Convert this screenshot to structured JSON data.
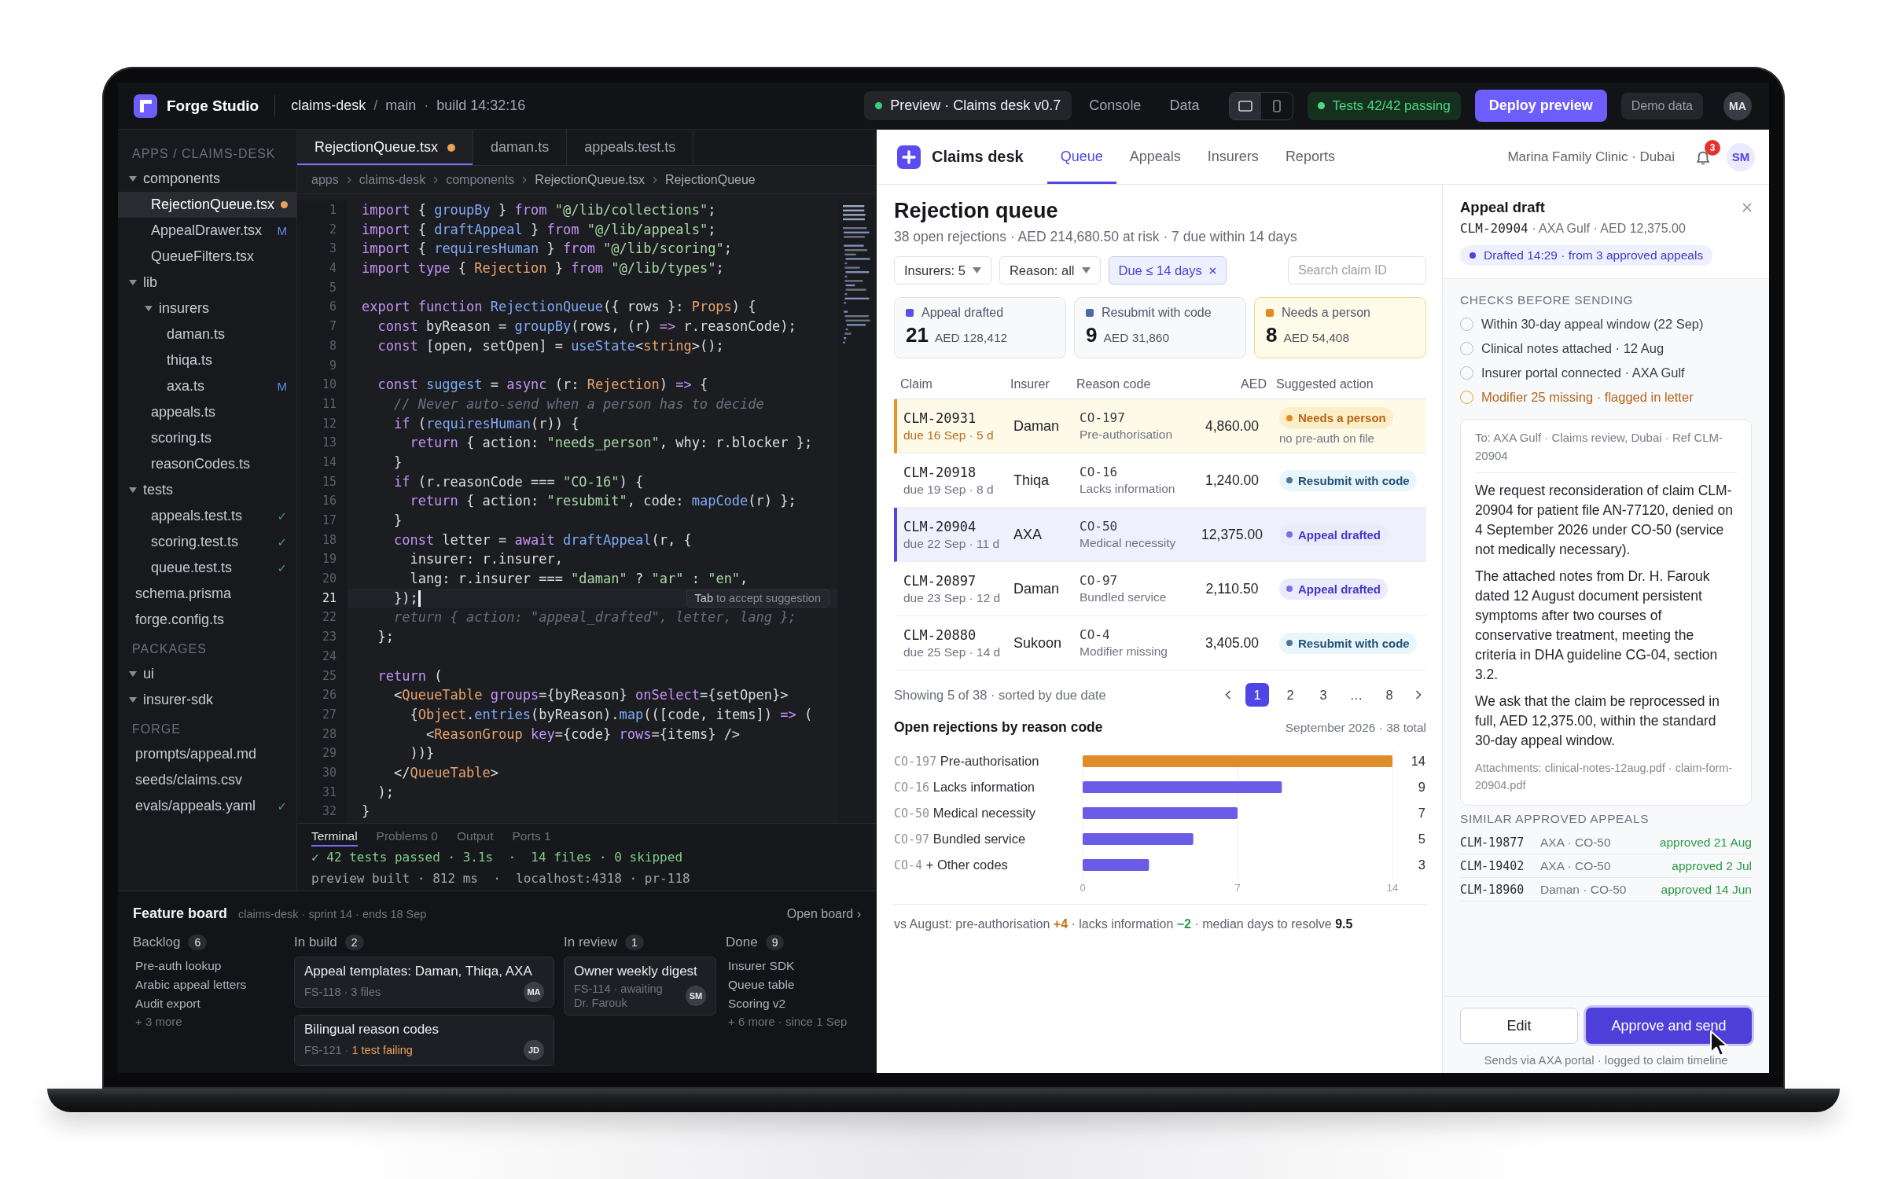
{
  "top_bar": {
    "app_name": "Forge Studio",
    "project": "claims-desk",
    "path_separator": "/",
    "branch": "main",
    "build_separator": "·",
    "build": "build 14:32:16",
    "views": [
      {
        "label": "Preview · Claims desk v0.7",
        "selected": true,
        "live": true
      },
      {
        "label": "Console",
        "selected": false,
        "live": false
      },
      {
        "label": "Data",
        "selected": false,
        "live": false
      }
    ],
    "devices": [
      {
        "kind": "desktop",
        "selected": true
      },
      {
        "kind": "mobile",
        "selected": false
      }
    ],
    "tests": {
      "label": "Tests 42/42 passing",
      "passing": true
    },
    "deploy_button": "Deploy preview",
    "demo_chip": "Demo data",
    "avatar": "MA"
  },
  "explorer": {
    "sections": [
      {
        "title": "APPS / CLAIMS-DESK",
        "items": [
          {
            "kind": "folder",
            "label": "components",
            "expanded": true,
            "selected": false,
            "children": [
              {
                "kind": "file",
                "label": "RejectionQueue.tsx",
                "selected": true,
                "unsaved": true
              },
              {
                "kind": "file",
                "label": "AppealDrawer.tsx",
                "selected": false,
                "unsaved": false,
                "badge": {
                  "kind": "modified",
                  "text": "M"
                }
              },
              {
                "kind": "file",
                "label": "QueueFilters.tsx",
                "selected": false,
                "unsaved": false
              }
            ]
          },
          {
            "kind": "folder",
            "label": "lib",
            "expanded": true,
            "selected": false,
            "children": [
              {
                "kind": "folder",
                "label": "insurers",
                "expanded": true,
                "selected": false,
                "children": [
                  {
                    "kind": "file",
                    "label": "daman.ts",
                    "selected": false,
                    "unsaved": false
                  },
                  {
                    "kind": "file",
                    "label": "thiqa.ts",
                    "selected": false,
                    "unsaved": false
                  },
                  {
                    "kind": "file",
                    "label": "axa.ts",
                    "selected": false,
                    "unsaved": false,
                    "badge": {
                      "kind": "modified",
                      "text": "M"
                    }
                  }
                ]
              },
              {
                "kind": "file",
                "label": "appeals.ts",
                "selected": false,
                "unsaved": false
              },
              {
                "kind": "file",
                "label": "scoring.ts",
                "selected": false,
                "unsaved": false
              },
              {
                "kind": "file",
                "label": "reasonCodes.ts",
                "selected": false,
                "unsaved": false
              }
            ]
          },
          {
            "kind": "folder",
            "label": "tests",
            "expanded": true,
            "selected": false,
            "children": [
              {
                "kind": "file",
                "label": "appeals.test.ts",
                "selected": false,
                "unsaved": false,
                "badge": {
                  "kind": "passing",
                  "text": "✓"
                }
              },
              {
                "kind": "file",
                "label": "scoring.test.ts",
                "selected": false,
                "unsaved": false,
                "badge": {
                  "kind": "passing",
                  "text": "✓"
                }
              },
              {
                "kind": "file",
                "label": "queue.test.ts",
                "selected": false,
                "unsaved": false,
                "badge": {
                  "kind": "passing",
                  "text": "✓"
                }
              }
            ]
          },
          {
            "kind": "file",
            "label": "schema.prisma",
            "selected": false,
            "unsaved": false
          },
          {
            "kind": "file",
            "label": "forge.config.ts",
            "selected": false,
            "unsaved": false
          }
        ]
      },
      {
        "title": "PACKAGES",
        "items": [
          {
            "kind": "folder",
            "label": "ui",
            "expanded": true,
            "selected": false
          },
          {
            "kind": "folder",
            "label": "insurer-sdk",
            "expanded": true,
            "selected": false
          }
        ]
      },
      {
        "title": "FORGE",
        "items": [
          {
            "kind": "file",
            "label": "prompts/appeal.md",
            "selected": false,
            "unsaved": false
          },
          {
            "kind": "file",
            "label": "seeds/claims.csv",
            "selected": false,
            "unsaved": false
          },
          {
            "kind": "file",
            "label": "evals/appeals.yaml",
            "selected": false,
            "unsaved": false,
            "badge": {
              "kind": "passing",
              "text": "✓"
            }
          }
        ]
      }
    ]
  },
  "editor": {
    "tabs": [
      {
        "label": "RejectionQueue.tsx",
        "selected": true,
        "unsaved": true
      },
      {
        "label": "daman.ts",
        "selected": false,
        "unsaved": false
      },
      {
        "label": "appeals.test.ts",
        "selected": false,
        "unsaved": false
      }
    ],
    "breadcrumb": [
      "apps",
      "claims-desk",
      "components",
      "RejectionQueue.tsx",
      "RejectionQueue"
    ],
    "lines": [
      {
        "number": "1",
        "current": false,
        "tokens": [
          {
            "kind": "keyword",
            "text": "import"
          },
          {
            "kind": "plain",
            "text": " { "
          },
          {
            "kind": "function",
            "text": "groupBy"
          },
          {
            "kind": "plain",
            "text": " } "
          },
          {
            "kind": "keyword",
            "text": "from"
          },
          {
            "kind": "string",
            "text": " \"@/lib/collections\""
          },
          {
            "kind": "plain",
            "text": ";"
          }
        ]
      },
      {
        "number": "2",
        "current": false,
        "tokens": [
          {
            "kind": "keyword",
            "text": "import"
          },
          {
            "kind": "plain",
            "text": " { "
          },
          {
            "kind": "function",
            "text": "draftAppeal"
          },
          {
            "kind": "plain",
            "text": " } "
          },
          {
            "kind": "keyword",
            "text": "from"
          },
          {
            "kind": "string",
            "text": " \"@/lib/appeals\""
          },
          {
            "kind": "plain",
            "text": ";"
          }
        ]
      },
      {
        "number": "3",
        "current": false,
        "tokens": [
          {
            "kind": "keyword",
            "text": "import"
          },
          {
            "kind": "plain",
            "text": " { "
          },
          {
            "kind": "function",
            "text": "requiresHuman"
          },
          {
            "kind": "plain",
            "text": " } "
          },
          {
            "kind": "keyword",
            "text": "from"
          },
          {
            "kind": "string",
            "text": " \"@/lib/scoring\""
          },
          {
            "kind": "plain",
            "text": ";"
          }
        ]
      },
      {
        "number": "4",
        "current": false,
        "tokens": [
          {
            "kind": "keyword",
            "text": "import type"
          },
          {
            "kind": "plain",
            "text": " { "
          },
          {
            "kind": "type",
            "text": "Rejection"
          },
          {
            "kind": "plain",
            "text": " } "
          },
          {
            "kind": "keyword",
            "text": "from"
          },
          {
            "kind": "string",
            "text": " \"@/lib/types\""
          },
          {
            "kind": "plain",
            "text": ";"
          }
        ]
      },
      {
        "number": "5",
        "current": false
      },
      {
        "number": "6",
        "current": false,
        "tokens": [
          {
            "kind": "keyword",
            "text": "export function"
          },
          {
            "kind": "function",
            "text": " RejectionQueue"
          },
          {
            "kind": "plain",
            "text": "({ rows }: "
          },
          {
            "kind": "type",
            "text": "Props"
          },
          {
            "kind": "plain",
            "text": ") {"
          }
        ]
      },
      {
        "number": "7",
        "current": false,
        "tokens": [
          {
            "kind": "keyword",
            "text": "  const"
          },
          {
            "kind": "plain",
            "text": " byReason = "
          },
          {
            "kind": "function",
            "text": "groupBy"
          },
          {
            "kind": "plain",
            "text": "(rows, (r) "
          },
          {
            "kind": "keyword",
            "text": "=>"
          },
          {
            "kind": "plain",
            "text": " r.reasonCode);"
          }
        ]
      },
      {
        "number": "8",
        "current": false,
        "tokens": [
          {
            "kind": "keyword",
            "text": "  const"
          },
          {
            "kind": "plain",
            "text": " [open, setOpen] = "
          },
          {
            "kind": "function",
            "text": "useState"
          },
          {
            "kind": "plain",
            "text": "<"
          },
          {
            "kind": "type",
            "text": "string"
          },
          {
            "kind": "plain",
            "text": ">();"
          }
        ]
      },
      {
        "number": "9",
        "current": false
      },
      {
        "number": "10",
        "current": false,
        "tokens": [
          {
            "kind": "keyword",
            "text": "  const"
          },
          {
            "kind": "function",
            "text": " suggest"
          },
          {
            "kind": "plain",
            "text": " = "
          },
          {
            "kind": "keyword",
            "text": "async"
          },
          {
            "kind": "plain",
            "text": " (r: "
          },
          {
            "kind": "type",
            "text": "Rejection"
          },
          {
            "kind": "plain",
            "text": ") "
          },
          {
            "kind": "keyword",
            "text": "=>"
          },
          {
            "kind": "plain",
            "text": " {"
          }
        ]
      },
      {
        "number": "11",
        "current": false,
        "tokens": [
          {
            "kind": "comment",
            "text": "    // Never auto-send when a person has to decide"
          }
        ]
      },
      {
        "number": "12",
        "current": false,
        "tokens": [
          {
            "kind": "keyword",
            "text": "    if"
          },
          {
            "kind": "plain",
            "text": " ("
          },
          {
            "kind": "function",
            "text": "requiresHuman"
          },
          {
            "kind": "plain",
            "text": "(r)) {"
          }
        ]
      },
      {
        "number": "13",
        "current": false,
        "tokens": [
          {
            "kind": "keyword",
            "text": "      return"
          },
          {
            "kind": "plain",
            "text": " { action: "
          },
          {
            "kind": "string",
            "text": "\"needs_person\""
          },
          {
            "kind": "plain",
            "text": ", why: r.blocker };"
          }
        ]
      },
      {
        "number": "14",
        "current": false,
        "tokens": [
          {
            "kind": "plain",
            "text": "    }"
          }
        ]
      },
      {
        "number": "15",
        "current": false,
        "tokens": [
          {
            "kind": "keyword",
            "text": "    if"
          },
          {
            "kind": "plain",
            "text": " (r.reasonCode === "
          },
          {
            "kind": "string",
            "text": "\"CO-16\""
          },
          {
            "kind": "plain",
            "text": ") {"
          }
        ]
      },
      {
        "number": "16",
        "current": false,
        "tokens": [
          {
            "kind": "keyword",
            "text": "      return"
          },
          {
            "kind": "plain",
            "text": " { action: "
          },
          {
            "kind": "string",
            "text": "\"resubmit\""
          },
          {
            "kind": "plain",
            "text": ", code: "
          },
          {
            "kind": "function",
            "text": "mapCode"
          },
          {
            "kind": "plain",
            "text": "(r) };"
          }
        ]
      },
      {
        "number": "17",
        "current": false,
        "tokens": [
          {
            "kind": "plain",
            "text": "    }"
          }
        ]
      },
      {
        "number": "18",
        "current": false,
        "tokens": [
          {
            "kind": "keyword",
            "text": "    const"
          },
          {
            "kind": "plain",
            "text": " letter = "
          },
          {
            "kind": "keyword",
            "text": "await"
          },
          {
            "kind": "function",
            "text": " draftAppeal"
          },
          {
            "kind": "plain",
            "text": "(r, {"
          }
        ]
      },
      {
        "number": "19",
        "current": false,
        "tokens": [
          {
            "kind": "plain",
            "text": "      insurer: r.insurer,"
          }
        ]
      },
      {
        "number": "20",
        "current": false,
        "tokens": [
          {
            "kind": "plain",
            "text": "      lang: r.insurer === "
          },
          {
            "kind": "string",
            "text": "\"daman\""
          },
          {
            "kind": "plain",
            "text": " ? "
          },
          {
            "kind": "string",
            "text": "\"ar\""
          },
          {
            "kind": "plain",
            "text": " : "
          },
          {
            "kind": "string",
            "text": "\"en\""
          },
          {
            "kind": "plain",
            "text": ","
          }
        ]
      },
      {
        "number": "21",
        "current": true,
        "tokens": [
          {
            "kind": "plain",
            "text": "    });"
          }
        ],
        "hint": "**Tab** to accept suggestion"
      },
      {
        "number": "22",
        "current": false,
        "tokens": [
          {
            "kind": "ghost",
            "text": "    return { action: \"appeal_drafted\", letter, lang };"
          }
        ]
      },
      {
        "number": "23",
        "current": false,
        "tokens": [
          {
            "kind": "plain",
            "text": "  };"
          }
        ]
      },
      {
        "number": "24",
        "current": false
      },
      {
        "number": "25",
        "current": false,
        "tokens": [
          {
            "kind": "keyword",
            "text": "  return"
          },
          {
            "kind": "plain",
            "text": " ("
          }
        ]
      },
      {
        "number": "26",
        "current": false,
        "tokens": [
          {
            "kind": "plain",
            "text": "    <"
          },
          {
            "kind": "type",
            "text": "QueueTable"
          },
          {
            "kind": "attribute",
            "text": " groups"
          },
          {
            "kind": "plain",
            "text": "={byReason} "
          },
          {
            "kind": "attribute",
            "text": "onSelect"
          },
          {
            "kind": "plain",
            "text": "={setOpen}>"
          }
        ]
      },
      {
        "number": "27",
        "current": false,
        "tokens": [
          {
            "kind": "plain",
            "text": "      {"
          },
          {
            "kind": "type",
            "text": "Object"
          },
          {
            "kind": "plain",
            "text": "."
          },
          {
            "kind": "function",
            "text": "entries"
          },
          {
            "kind": "plain",
            "text": "(byReason)."
          },
          {
            "kind": "function",
            "text": "map"
          },
          {
            "kind": "plain",
            "text": "(([code, items]) "
          },
          {
            "kind": "keyword",
            "text": "=>"
          },
          {
            "kind": "plain",
            "text": " ("
          }
        ]
      },
      {
        "number": "28",
        "current": false,
        "tokens": [
          {
            "kind": "plain",
            "text": "        <"
          },
          {
            "kind": "type",
            "text": "ReasonGroup"
          },
          {
            "kind": "attribute",
            "text": " key"
          },
          {
            "kind": "plain",
            "text": "={code} "
          },
          {
            "kind": "attribute",
            "text": "rows"
          },
          {
            "kind": "plain",
            "text": "={items} />"
          }
        ]
      },
      {
        "number": "29",
        "current": false,
        "tokens": [
          {
            "kind": "plain",
            "text": "      ))}"
          }
        ]
      },
      {
        "number": "30",
        "current": false,
        "tokens": [
          {
            "kind": "plain",
            "text": "    </"
          },
          {
            "kind": "type",
            "text": "QueueTable"
          },
          {
            "kind": "plain",
            "text": ">"
          }
        ]
      },
      {
        "number": "31",
        "current": false,
        "tokens": [
          {
            "kind": "plain",
            "text": "  );"
          }
        ]
      },
      {
        "number": "32",
        "current": false,
        "tokens": [
          {
            "kind": "plain",
            "text": "}"
          }
        ]
      }
    ],
    "panel_tabs": [
      {
        "label": "Terminal",
        "selected": true
      },
      {
        "label": "Problems 0",
        "selected": false
      },
      {
        "label": "Output",
        "selected": false
      },
      {
        "label": "Ports 1",
        "selected": false
      }
    ],
    "terminal": [
      {
        "kind": "success",
        "text": "✓ 42 tests passed · 3.1s  ·  14 files · 0 skipped"
      },
      {
        "kind": "info",
        "text": "preview built · 812 ms  ·  localhost:4318 · pr-118"
      }
    ]
  },
  "feature_board": {
    "title": "Feature board",
    "meta": "claims-desk · sprint 14 · ends 18 Sep",
    "open_link": "Open board ›",
    "columns": [
      {
        "kind": "list",
        "title": "Backlog",
        "count": "6",
        "items": [
          "Pre-auth lookup",
          "Arabic appeal letters",
          "Audit export"
        ],
        "more": "+ 3 more"
      },
      {
        "kind": "cards",
        "title": "In build",
        "count": "2",
        "cards": [
          {
            "title": "Appeal templates: Daman, Thiqa, AXA",
            "meta": "FS-118 · 3 files",
            "avatar": "MA"
          },
          {
            "title": "Bilingual reason codes",
            "meta": "FS-121 ·",
            "warning": "1 test failing",
            "avatar": "JD"
          }
        ]
      },
      {
        "kind": "cards",
        "title": "In review",
        "count": "1",
        "cards": [
          {
            "title": "Owner weekly digest",
            "meta": "FS-114 · awaiting Dr. Farouk",
            "avatar": "SM"
          }
        ]
      },
      {
        "kind": "list",
        "title": "Done",
        "count": "9",
        "items": [
          "Insurer SDK",
          "Queue table",
          "Scoring v2"
        ],
        "more": "+ 6 more · since 1 Sep"
      }
    ]
  },
  "claims_app": {
    "title": "Claims desk",
    "tabs": [
      {
        "label": "Queue",
        "selected": true
      },
      {
        "label": "Appeals",
        "selected": false
      },
      {
        "label": "Insurers",
        "selected": false
      },
      {
        "label": "Reports",
        "selected": false
      }
    ],
    "clinic": "Marina Family Clinic · Dubai",
    "notification_count": "3",
    "avatar": "SM",
    "queue": {
      "title": "Rejection queue",
      "summary": "38 open rejections · AED 214,680.50 at risk · 7 due within 14 days",
      "filters": [
        {
          "kind": "dropdown",
          "label": "Insurers: 5",
          "active": false
        },
        {
          "kind": "dropdown",
          "label": "Reason: all",
          "active": false
        },
        {
          "kind": "removable",
          "label": "Due ≤ 14 days",
          "active": true
        }
      ],
      "search": {
        "placeholder": "Search claim ID"
      },
      "summary_cards": [
        {
          "kind": "drafted",
          "label": "Appeal drafted",
          "count": "21",
          "amount": "AED 128,412",
          "color": "#5a50e6"
        },
        {
          "kind": "resubmit",
          "label": "Resubmit with code",
          "count": "9",
          "amount": "AED 31,860",
          "color": "#4d6aa8"
        },
        {
          "kind": "person",
          "label": "Needs a person",
          "count": "8",
          "amount": "AED 54,408",
          "color": "#e5891f"
        }
      ],
      "table": {
        "columns": [
          "Claim",
          "Insurer",
          "Reason code",
          "AED",
          "Suggested action"
        ],
        "rows": [
          {
            "claim": "CLM-20931",
            "due": "due 16 Sep · 5 d",
            "insurer": "Daman",
            "code": "CO-197",
            "reason": "Pre-authorisation",
            "amount": "4,860.00",
            "action": {
              "kind": "person",
              "label": "Needs a person"
            },
            "note": "no pre-auth on file",
            "flagged": true,
            "selected": false
          },
          {
            "claim": "CLM-20918",
            "due": "due 19 Sep · 8 d",
            "insurer": "Thiqa",
            "code": "CO-16",
            "reason": "Lacks information",
            "amount": "1,240.00",
            "action": {
              "kind": "resubmit",
              "label": "Resubmit with code"
            },
            "flagged": false,
            "selected": false
          },
          {
            "claim": "CLM-20904",
            "due": "due 22 Sep · 11 d",
            "insurer": "AXA",
            "code": "CO-50",
            "reason": "Medical necessity",
            "amount": "12,375.00",
            "action": {
              "kind": "drafted",
              "label": "Appeal drafted"
            },
            "flagged": false,
            "selected": true
          },
          {
            "claim": "CLM-20897",
            "due": "due 23 Sep · 12 d",
            "insurer": "Daman",
            "code": "CO-97",
            "reason": "Bundled service",
            "amount": "2,110.50",
            "action": {
              "kind": "drafted",
              "label": "Appeal drafted"
            },
            "flagged": false,
            "selected": false
          },
          {
            "claim": "CLM-20880",
            "due": "due 25 Sep · 14 d",
            "insurer": "Sukoon",
            "code": "CO-4",
            "reason": "Modifier missing",
            "amount": "3,405.00",
            "action": {
              "kind": "resubmit",
              "label": "Resubmit with code"
            },
            "flagged": false,
            "selected": false
          }
        ]
      },
      "pagination": {
        "text": "Showing 5 of 38 · sorted by due date",
        "pages": [
          {
            "label": "1",
            "selected": true
          },
          {
            "label": "2",
            "selected": false
          },
          {
            "label": "3",
            "selected": false
          },
          {
            "label": "…",
            "selected": false
          },
          {
            "label": "8",
            "selected": false
          }
        ]
      },
      "chart": {
        "title": "Open rejections by reason code",
        "period": "September 2026 · 38 total",
        "chart_data": {
          "type": "bar",
          "orientation": "horizontal",
          "categories": [
            "CO-197 Pre-authorisation",
            "CO-16 Lacks information",
            "CO-50 Medical necessity",
            "CO-97 Bundled service",
            "CO-4 + Other codes"
          ],
          "series": [
            {
              "color": "#e08c2a",
              "values": [
                14,
                null,
                null,
                null,
                null
              ]
            },
            {
              "color": "#6b5ce7",
              "values": [
                null,
                9,
                7,
                5,
                3
              ]
            }
          ],
          "xlim": [
            0,
            14
          ],
          "xticks": [
            0,
            7,
            14
          ],
          "data_labels": true
        }
      },
      "comparison": [
        {
          "kind": "plain",
          "text": "vs August: pre-authorisation "
        },
        {
          "kind": "up",
          "text": "+4"
        },
        {
          "kind": "plain",
          "text": " · lacks information "
        },
        {
          "kind": "down",
          "text": "−2"
        },
        {
          "kind": "plain",
          "text": " · median days to resolve "
        },
        {
          "kind": "strong",
          "text": "9.5"
        }
      ]
    },
    "drawer": {
      "title": "Appeal draft",
      "claim": "CLM-20904",
      "details": " · AXA Gulf · AED 12,375.00",
      "status": "Drafted 14:29 · from 3 approved appeals",
      "checks_title": "CHECKS BEFORE SENDING",
      "checks": [
        {
          "kind": "ok",
          "label": "Within 30-day appeal window (22 Sep)"
        },
        {
          "kind": "ok",
          "label": "Clinical notes attached · 12 Aug"
        },
        {
          "kind": "ok",
          "label": "Insurer portal connected · AXA Gulf"
        },
        {
          "kind": "warn",
          "label": "Modifier 25 missing · flagged in letter"
        }
      ],
      "letter": {
        "to": "To: AXA Gulf · Claims review, Dubai · Ref CLM-20904",
        "paragraphs": [
          "We request reconsideration of claim CLM-20904 for patient file AN-77120, denied on 4 September 2026 under CO-50 (service not medically necessary).",
          "The attached notes from Dr. H. Farouk dated 12 August document persistent symptoms after two courses of conservative treatment, meeting the criteria in DHA guideline CG-04, section 3.2.",
          "We ask that the claim be reprocessed in full, AED 12,375.00, within the standard 30-day appeal window."
        ],
        "attachments": "Attachments: clinical-notes-12aug.pdf · claim-form-20904.pdf"
      },
      "similar_title": "SIMILAR APPROVED APPEALS",
      "similar": [
        {
          "claim": "CLM-19877",
          "detail": "AXA · CO-50",
          "status": "approved 21 Aug"
        },
        {
          "claim": "CLM-19402",
          "detail": "AXA · CO-50",
          "status": "approved 2 Jul"
        },
        {
          "claim": "CLM-18960",
          "detail": "Daman · CO-50",
          "status": "approved 14 Jun"
        }
      ],
      "edit_button": "Edit",
      "approve_button": "Approve and send",
      "footnote": "Sends via AXA portal · logged to claim timeline"
    }
  }
}
